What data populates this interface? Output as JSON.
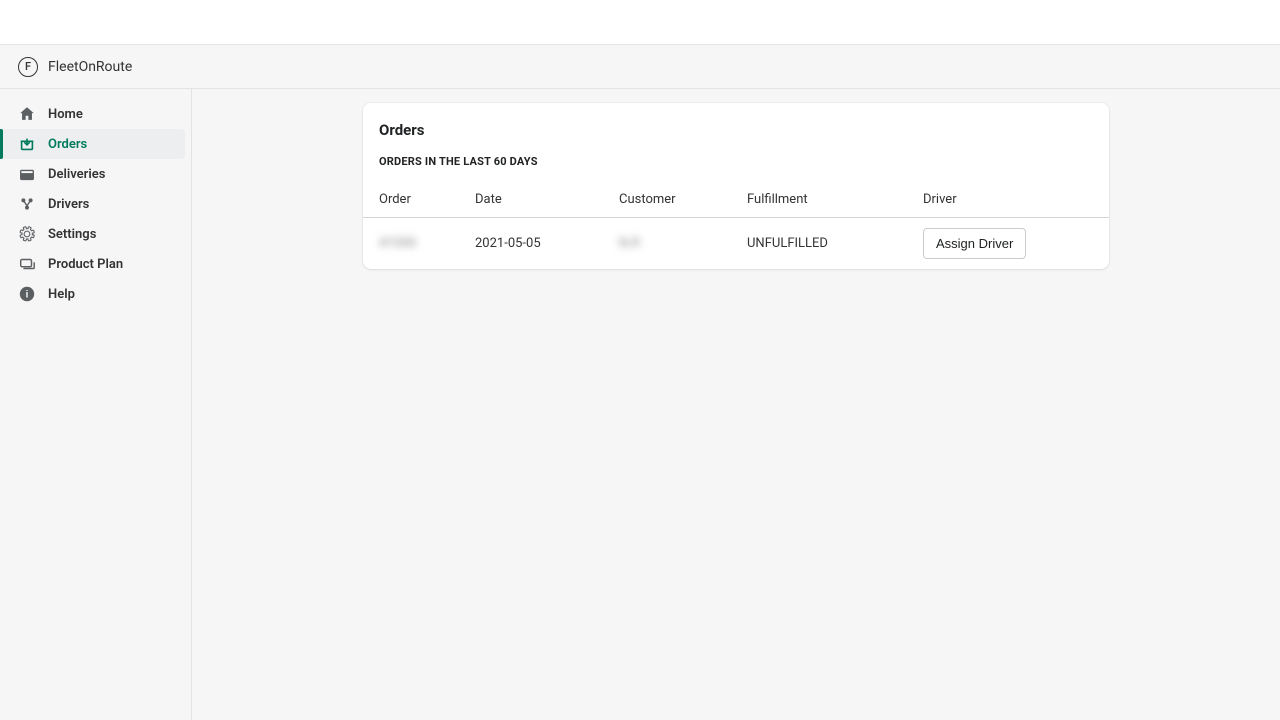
{
  "brand": {
    "name": "FleetOnRoute",
    "logo_letter": "F"
  },
  "sidebar": {
    "items": [
      {
        "label": "Home",
        "icon": "home-icon",
        "active": false
      },
      {
        "label": "Orders",
        "icon": "orders-icon",
        "active": true
      },
      {
        "label": "Deliveries",
        "icon": "deliveries-icon",
        "active": false
      },
      {
        "label": "Drivers",
        "icon": "drivers-icon",
        "active": false
      },
      {
        "label": "Settings",
        "icon": "settings-icon",
        "active": false
      },
      {
        "label": "Product Plan",
        "icon": "plan-icon",
        "active": false
      },
      {
        "label": "Help",
        "icon": "help-icon",
        "active": false
      }
    ]
  },
  "page": {
    "title": "Orders",
    "subtitle": "ORDERS IN THE LAST 60 DAYS"
  },
  "table": {
    "columns": [
      "Order",
      "Date",
      "Customer",
      "Fulfillment",
      "Driver"
    ],
    "rows": [
      {
        "order": "#1090",
        "order_blurred": true,
        "date": "2021-05-05",
        "customer": "N.R",
        "customer_blurred": true,
        "fulfillment": "UNFULFILLED",
        "driver_action": "Assign Driver"
      }
    ]
  }
}
